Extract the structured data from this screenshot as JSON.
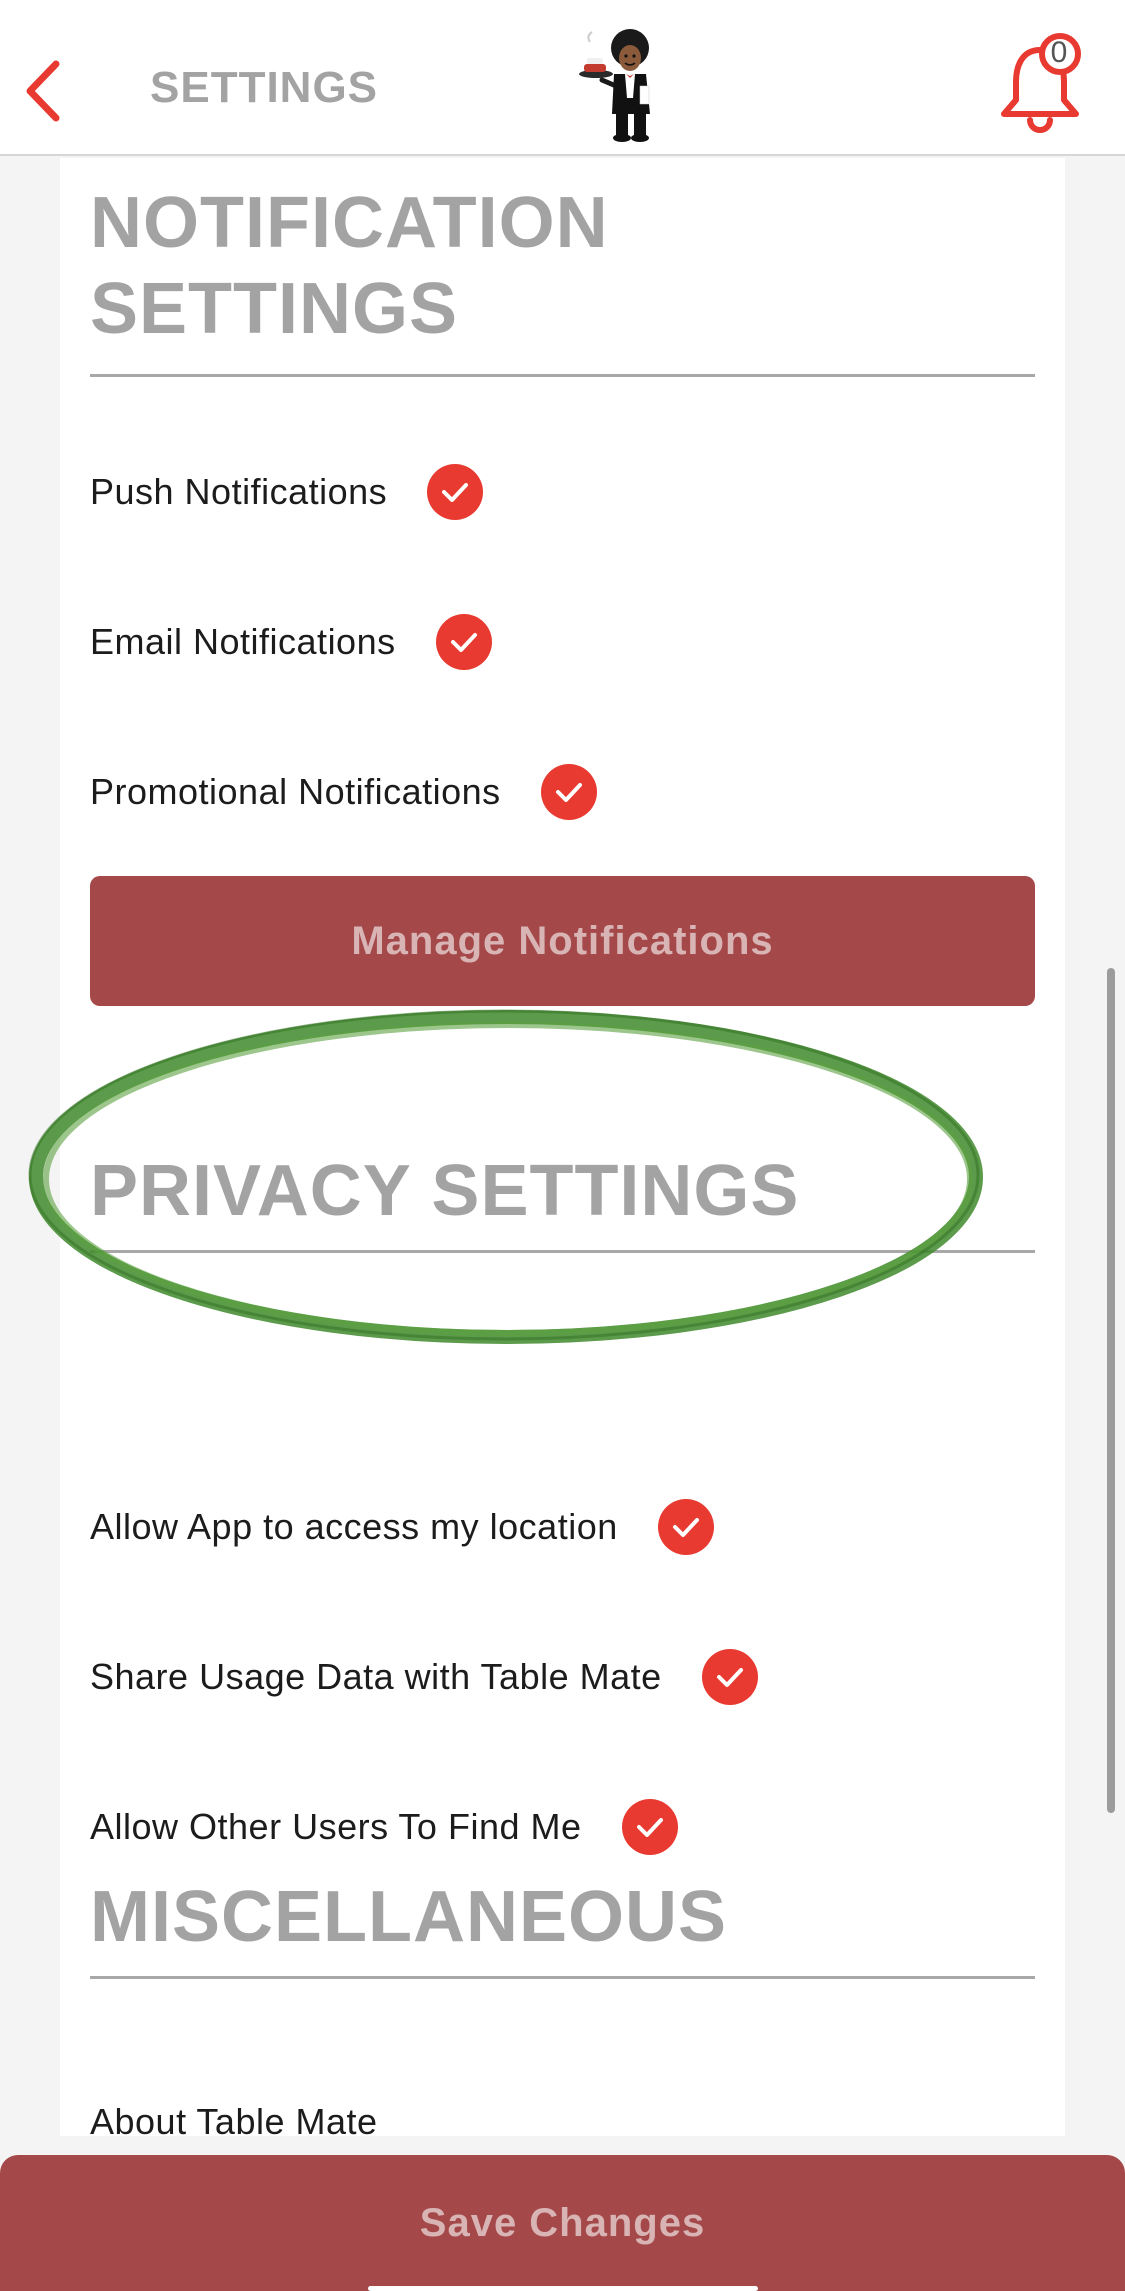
{
  "header": {
    "title": "SETTINGS",
    "notification_count": "0",
    "back_icon": "chevron-left-icon",
    "bell_icon": "bell-icon",
    "logo": "waiter-mascot-logo"
  },
  "notification_settings": {
    "title_line1": "NOTIFICATION",
    "title_line2": "SETTINGS",
    "items": [
      {
        "label": "Push Notifications",
        "checked": true
      },
      {
        "label": "Email Notifications",
        "checked": true
      },
      {
        "label": "Promotional Notifications",
        "checked": true
      }
    ],
    "manage_button": "Manage Notifications"
  },
  "privacy_settings": {
    "title": "PRIVACY SETTINGS",
    "items": [
      {
        "label": "Allow App to access my location",
        "checked": true
      },
      {
        "label": "Share Usage Data with Table Mate",
        "checked": true
      },
      {
        "label": "Allow Other Users To Find Me",
        "checked": true
      }
    ]
  },
  "miscellaneous": {
    "title": "MISCELLANEOUS",
    "items": [
      {
        "label": "About Table Mate"
      }
    ]
  },
  "footer": {
    "save_button": "Save Changes"
  },
  "colors": {
    "accent_red": "#e83a30",
    "button_maroon": "#a54849",
    "button_text": "#d8b4b5",
    "heading_gray": "#a3a3a3",
    "annotation_green": "#3f8a2c"
  }
}
